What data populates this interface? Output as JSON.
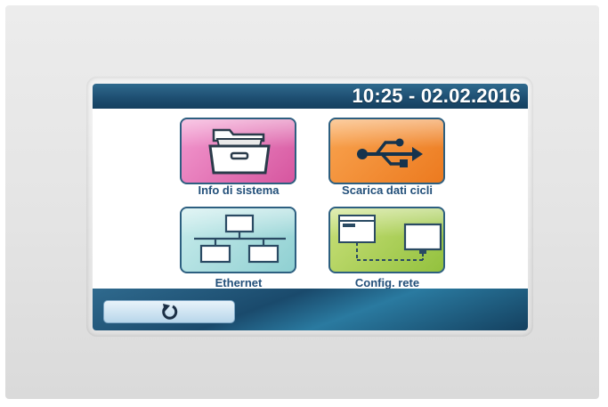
{
  "header": {
    "datetime": "10:25 - 02.02.2016"
  },
  "tiles": [
    {
      "label": "Info di sistema",
      "icon": "folder-icon",
      "color": "#e06fb3"
    },
    {
      "label": "Scarica dati cicli",
      "icon": "usb-icon",
      "color": "#f08a2c"
    },
    {
      "label": "Ethernet",
      "icon": "network-icon",
      "color": "#a9dfe0"
    },
    {
      "label": "Config. rete",
      "icon": "network-config-icon",
      "color": "#aacd55"
    }
  ],
  "footer": {
    "back_icon": "back-arrow-icon"
  },
  "colors": {
    "bar": "#1d4d70",
    "label": "#23507a"
  }
}
